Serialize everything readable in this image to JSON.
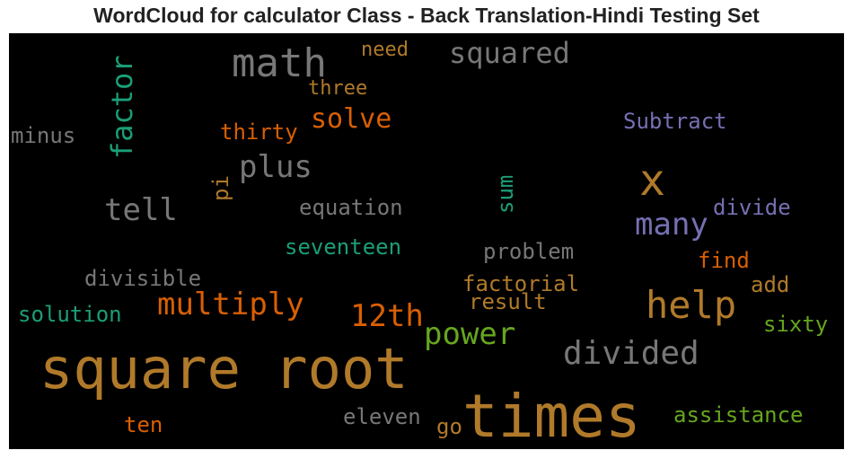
{
  "title": "WordCloud for calculator Class - Back Translation-Hindi Testing Set",
  "words": [
    {
      "text": "math",
      "color": "#777777"
    },
    {
      "text": "need",
      "color": "#b07a2a"
    },
    {
      "text": "squared",
      "color": "#777777"
    },
    {
      "text": "factor",
      "color": "#1b9e77"
    },
    {
      "text": "three",
      "color": "#b07a2a"
    },
    {
      "text": "solve",
      "color": "#d95f02"
    },
    {
      "text": "thirty",
      "color": "#d95f02"
    },
    {
      "text": "minus",
      "color": "#777777"
    },
    {
      "text": "Subtract",
      "color": "#7570b3"
    },
    {
      "text": "plus",
      "color": "#777777"
    },
    {
      "text": "x",
      "color": "#b07a2a"
    },
    {
      "text": "pi",
      "color": "#b07a2a"
    },
    {
      "text": "sum",
      "color": "#1b9e77"
    },
    {
      "text": "tell",
      "color": "#777777"
    },
    {
      "text": "equation",
      "color": "#777777"
    },
    {
      "text": "divide",
      "color": "#7570b3"
    },
    {
      "text": "many",
      "color": "#7570b3"
    },
    {
      "text": "seventeen",
      "color": "#1b9e77"
    },
    {
      "text": "problem",
      "color": "#777777"
    },
    {
      "text": "find",
      "color": "#d95f02"
    },
    {
      "text": "divisible",
      "color": "#777777"
    },
    {
      "text": "factorial",
      "color": "#b07a2a"
    },
    {
      "text": "add",
      "color": "#b07a2a"
    },
    {
      "text": "multiply",
      "color": "#d95f02"
    },
    {
      "text": "result",
      "color": "#b07a2a"
    },
    {
      "text": "help",
      "color": "#b07a2a"
    },
    {
      "text": "solution",
      "color": "#1b9e77"
    },
    {
      "text": "12th",
      "color": "#d95f02"
    },
    {
      "text": "sixty",
      "color": "#66a61e"
    },
    {
      "text": "power",
      "color": "#66a61e"
    },
    {
      "text": "divided",
      "color": "#777777"
    },
    {
      "text": "square root",
      "color": "#b07a2a"
    },
    {
      "text": "times",
      "color": "#b07a2a"
    },
    {
      "text": "eleven",
      "color": "#777777"
    },
    {
      "text": "assistance",
      "color": "#66a61e"
    },
    {
      "text": "ten",
      "color": "#d95f02"
    },
    {
      "text": "go",
      "color": "#b07a2a"
    }
  ]
}
